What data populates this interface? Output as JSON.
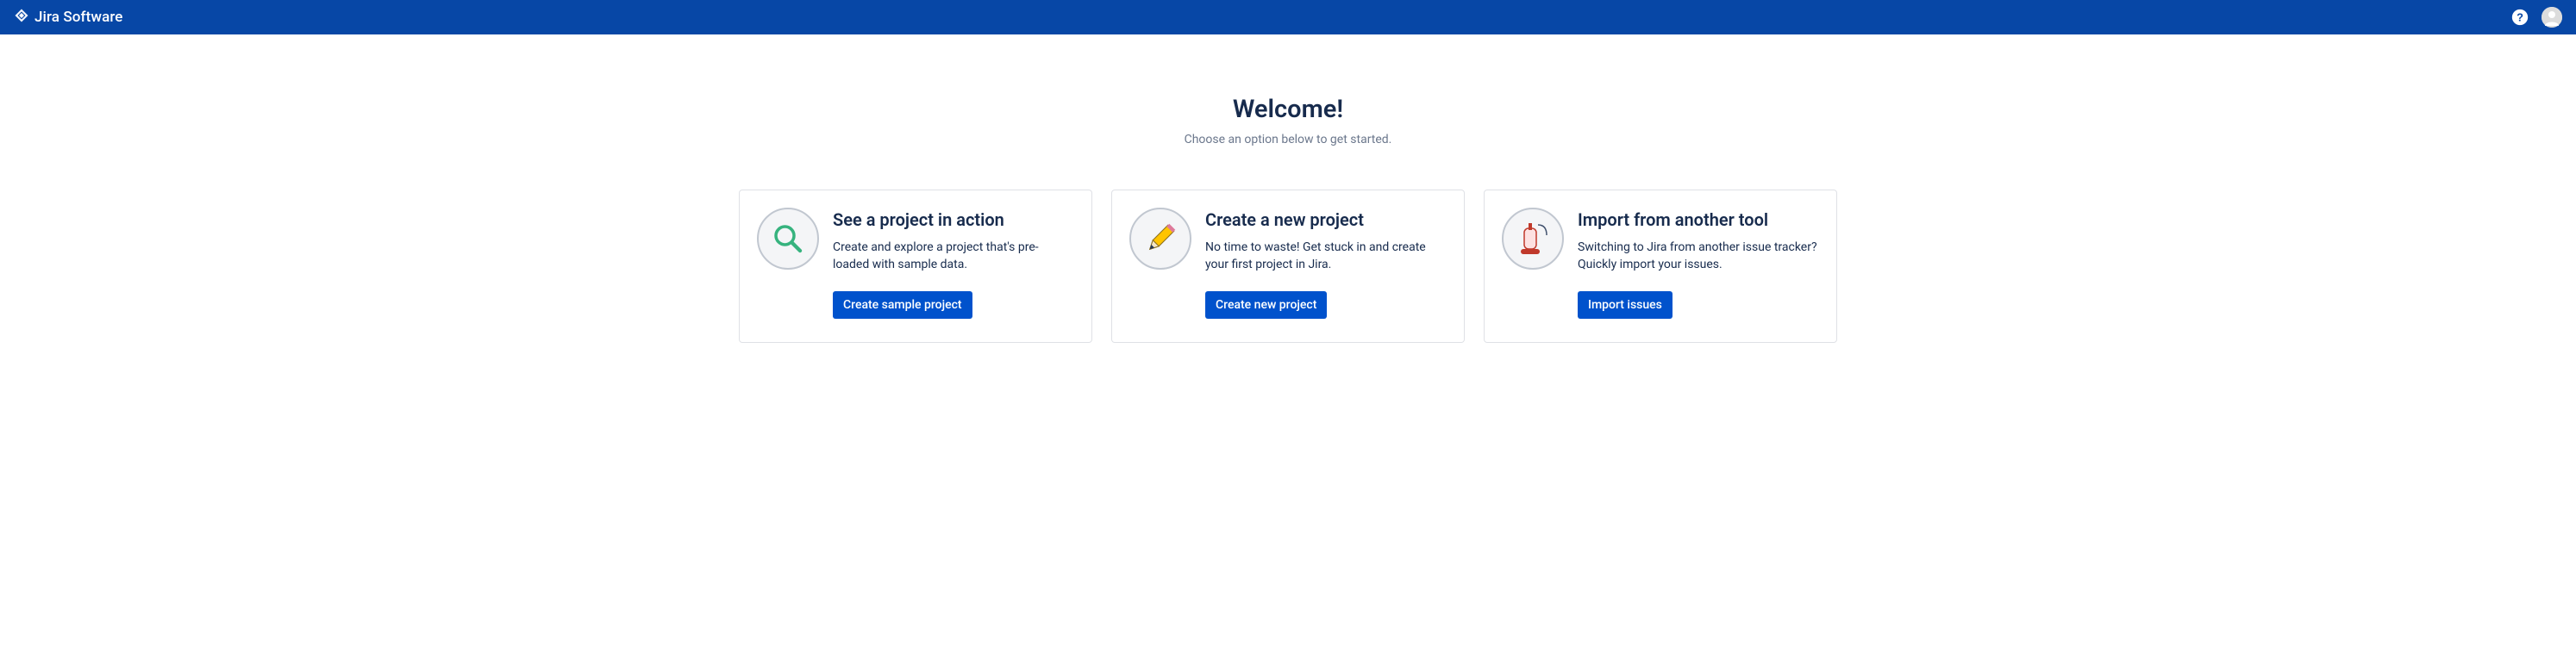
{
  "header": {
    "product_name": "Jira Software"
  },
  "main": {
    "title": "Welcome!",
    "subtitle": "Choose an option below to get started."
  },
  "cards": [
    {
      "icon": "magnifier-icon",
      "title": "See a project in action",
      "description": "Create and explore a project that's pre-loaded with sample data.",
      "button_label": "Create sample project"
    },
    {
      "icon": "pencil-icon",
      "title": "Create a new project",
      "description": "No time to waste! Get stuck in and create your first project in Jira.",
      "button_label": "Create new project"
    },
    {
      "icon": "vacuum-icon",
      "title": "Import from another tool",
      "description": "Switching to Jira from another issue tracker? Quickly import your issues.",
      "button_label": "Import issues"
    }
  ]
}
